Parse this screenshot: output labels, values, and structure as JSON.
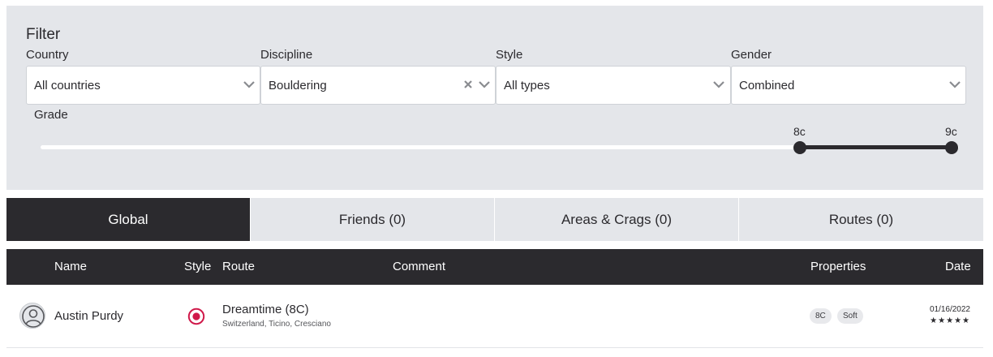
{
  "filter": {
    "title": "Filter",
    "fields": {
      "country": {
        "label": "Country",
        "value": "All countries"
      },
      "discipline": {
        "label": "Discipline",
        "value": "Bouldering"
      },
      "style": {
        "label": "Style",
        "value": "All types"
      },
      "gender": {
        "label": "Gender",
        "value": "Combined"
      }
    },
    "grade": {
      "label": "Grade",
      "min_label": "8c",
      "max_label": "9c",
      "range_start_fraction": 0.83,
      "range_end_fraction": 1.0
    }
  },
  "tabs": [
    {
      "label": "Global",
      "active": true
    },
    {
      "label": "Friends (0)",
      "active": false
    },
    {
      "label": "Areas & Crags (0)",
      "active": false
    },
    {
      "label": "Routes (0)",
      "active": false
    }
  ],
  "table": {
    "headers": {
      "name": "Name",
      "style": "Style",
      "route": "Route",
      "comment": "Comment",
      "properties": "Properties",
      "date": "Date"
    },
    "rows": [
      {
        "name": "Austin Purdy",
        "style_icon": "redpoint-icon",
        "route": "Dreamtime (8C)",
        "location": "Switzerland, Ticino, Cresciano",
        "comment": "",
        "properties": [
          "8C",
          "Soft"
        ],
        "date": "01/16/2022",
        "stars": "★★★★★"
      }
    ]
  },
  "colors": {
    "dark": "#2b2a2e",
    "panel": "#e4e6ea",
    "accent": "#d0194a"
  }
}
